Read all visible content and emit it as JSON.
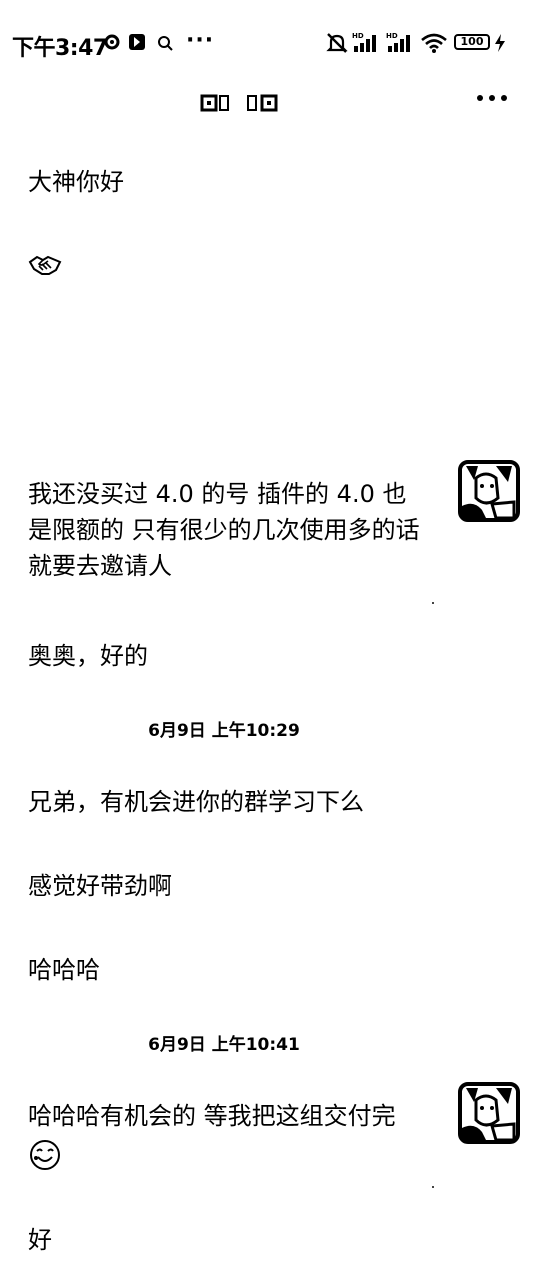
{
  "status_bar": {
    "time": "下午3:47",
    "battery": "100",
    "more": "···"
  },
  "header": {
    "more_menu": "⋮"
  },
  "chat": {
    "messages": [
      {
        "text": "大神你好"
      },
      {
        "text": "我还没买过 4.0 的号 插件的 4.0 也是限额的 只有很少的几次使用多的话就要去邀请人"
      },
      {
        "text": "奥奥，好的"
      },
      {
        "text": "兄弟，有机会进你的群学习下么"
      },
      {
        "text": "感觉好带劲啊"
      },
      {
        "text": "哈哈哈"
      },
      {
        "text": "哈哈哈有机会的 等我把这组交付完"
      },
      {
        "text": "好"
      }
    ],
    "timestamps": [
      "6月9日 上午10:29",
      "6月9日 上午10:41"
    ],
    "emojis": [
      "handshake-emoji",
      "grin-emoji"
    ]
  },
  "colors": {
    "background": "#ffffff",
    "text": "#000000"
  }
}
